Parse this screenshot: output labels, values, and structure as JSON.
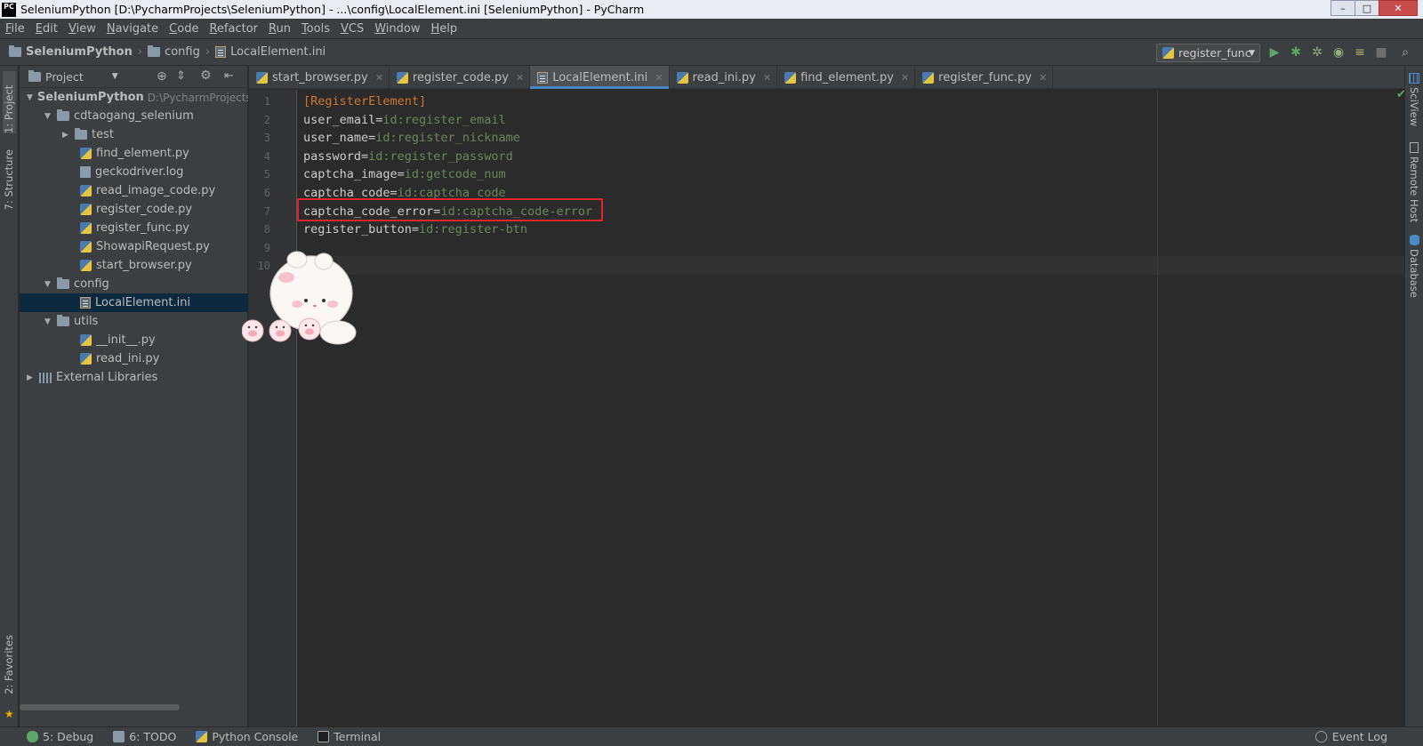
{
  "window": {
    "title": "SeleniumPython [D:\\PycharmProjects\\SeleniumPython] - ...\\config\\LocalElement.ini [SeleniumPython] - PyCharm",
    "logo": "PC",
    "buttons": [
      "–",
      "□",
      "✕"
    ]
  },
  "menu": [
    "File",
    "Edit",
    "View",
    "Navigate",
    "Code",
    "Refactor",
    "Run",
    "Tools",
    "VCS",
    "Window",
    "Help"
  ],
  "breadcrumb": {
    "project": "SeleniumPython",
    "folder": "config",
    "file": "LocalElement.ini"
  },
  "run_config": {
    "name": "register_func"
  },
  "left_tools": {
    "project": "1: Project",
    "structure": "7: Structure",
    "favorites": "2: Favorites"
  },
  "right_tools": {
    "sciview": "SciView",
    "remote_host": "Remote Host",
    "database": "Database"
  },
  "project_panel": {
    "title": "Project",
    "tree": [
      {
        "label": "SeleniumPython",
        "hint": "D:\\PycharmProjects",
        "kind": "project",
        "depth": 0,
        "expanded": true
      },
      {
        "label": "cdtaogang_selenium",
        "kind": "folder",
        "depth": 1,
        "expanded": true
      },
      {
        "label": "test",
        "kind": "folder",
        "depth": 2,
        "expanded": false
      },
      {
        "label": "find_element.py",
        "kind": "py",
        "depth": 3
      },
      {
        "label": "geckodriver.log",
        "kind": "log",
        "depth": 3
      },
      {
        "label": "read_image_code.py",
        "kind": "py",
        "depth": 3
      },
      {
        "label": "register_code.py",
        "kind": "py",
        "depth": 3
      },
      {
        "label": "register_func.py",
        "kind": "py",
        "depth": 3
      },
      {
        "label": "ShowapiRequest.py",
        "kind": "py",
        "depth": 3
      },
      {
        "label": "start_browser.py",
        "kind": "py",
        "depth": 3
      },
      {
        "label": "config",
        "kind": "folder",
        "depth": 1,
        "expanded": true
      },
      {
        "label": "LocalElement.ini",
        "kind": "ini",
        "depth": 3,
        "selected": true
      },
      {
        "label": "utils",
        "kind": "folder",
        "depth": 1,
        "expanded": true
      },
      {
        "label": "__init__.py",
        "kind": "py",
        "depth": 3
      },
      {
        "label": "read_ini.py",
        "kind": "py",
        "depth": 3
      },
      {
        "label": "External Libraries",
        "kind": "lib",
        "depth": 0,
        "expanded": false
      }
    ]
  },
  "editor_tabs": [
    {
      "label": "start_browser.py",
      "kind": "py"
    },
    {
      "label": "register_code.py",
      "kind": "py"
    },
    {
      "label": "LocalElement.ini",
      "kind": "ini",
      "active": true
    },
    {
      "label": "read_ini.py",
      "kind": "py"
    },
    {
      "label": "find_element.py",
      "kind": "py"
    },
    {
      "label": "register_func.py",
      "kind": "py"
    }
  ],
  "code_lines": [
    {
      "n": "1",
      "section": "[RegisterElement]"
    },
    {
      "n": "2",
      "key": "user_email=",
      "value": "id:register_email"
    },
    {
      "n": "3",
      "key": "user_name=",
      "value": "id:register_nickname"
    },
    {
      "n": "4",
      "key": "password=",
      "value": "id:register_password"
    },
    {
      "n": "5",
      "key": "captcha_image=",
      "value": "id:getcode_num"
    },
    {
      "n": "6",
      "key": "captcha_code=",
      "value": "id:captcha_code"
    },
    {
      "n": "7",
      "key": "captcha_code_error=",
      "value": "id:captcha_code-error"
    },
    {
      "n": "8",
      "key": "register_button=",
      "value": "id:register-btn"
    },
    {
      "n": "9"
    },
    {
      "n": "10"
    }
  ],
  "status_bar": {
    "debug": "5: Debug",
    "todo": "6: TODO",
    "python_console": "Python Console",
    "terminal": "Terminal",
    "event_log": "Event Log"
  },
  "colors": {
    "section": "#cc7832",
    "value": "#6a8759",
    "highlight_box": "#e0262a",
    "accent": "#4a88c7"
  }
}
